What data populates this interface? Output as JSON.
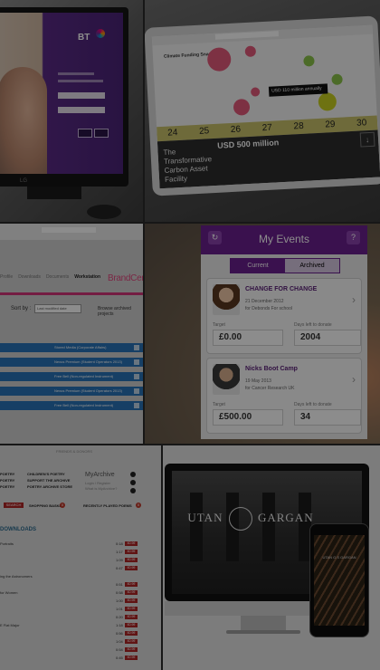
{
  "tile_bt": {
    "brand": "BT",
    "monitor_logo": "LG"
  },
  "tile_timeline": {
    "page_title": "Climate Funding Snapshot",
    "callout": "USD 110 million annually",
    "days": [
      "24",
      "25",
      "26",
      "27",
      "28",
      "29",
      "30"
    ],
    "feature_title": "The Transformative Carbon Asset Facility",
    "feature_amount": "USD 500 million",
    "download_icon": "arrow-down-icon"
  },
  "tile_auction": {
    "nav_items": [
      "Profile",
      "Downloads",
      "Documents",
      "Workstation"
    ],
    "brand_fragment": "BrandCentra",
    "sort_label": "Sort by :",
    "sort_value": "Last modified date",
    "browse_label": "Browse archived projects",
    "row_labels": [
      "Stored Media (Corporate Affairs)",
      "Nexus Premium (Student Operators 2013)",
      "Free Bell (Non-regulated Instrument)",
      "Nexus Premium (Student Operators 2013)",
      "Free Bell (Non-regulated Instrument)"
    ]
  },
  "tile_events": {
    "title": "My Events",
    "tabs": [
      "Current",
      "Archived"
    ],
    "events": [
      {
        "name": "CHANGE FOR CHANGE",
        "date": "21 December 2012",
        "for": "for Debonds For school",
        "target_label": "Target",
        "target": "£0.00",
        "days_label": "Days left to donate",
        "days": "2004"
      },
      {
        "name": "Nicks Boot Camp",
        "date": "19 May 2013",
        "for": "for Cancer Research UK",
        "target_label": "Target",
        "target": "£500.00",
        "days_label": "Days left to donate",
        "days": "34"
      }
    ]
  },
  "tile_poetry": {
    "banner": "FRIENDS & DONORS",
    "nav_col1": [
      "POETRY",
      "POETRY",
      "POETRY"
    ],
    "nav_col2": [
      "CHILDREN'S POETRY",
      "SUPPORT THE ARCHIVE",
      "POETRY ARCHIVE STORE"
    ],
    "myarchive": "MyArchive",
    "login_lines": [
      "Login / Register",
      "What is MyArchive?"
    ],
    "search_label": "SEARCH",
    "shopping_label": "SHOPPING BASKET",
    "shopping_count": "0",
    "recent_label": "RECENTLY PLAYED POEMS",
    "recent_count": "0",
    "downloads_heading": "DOWNLOADS",
    "tracks": [
      {
        "title": "Portraits",
        "dur": "0:18",
        "price": "£0.99"
      },
      {
        "title": "",
        "dur": "1:17",
        "price": "£0.99"
      },
      {
        "title": "",
        "dur": "1:09",
        "price": "£0.99"
      },
      {
        "title": "",
        "dur": "0:47",
        "price": "£0.99"
      },
      {
        "title": "ing the Astronomers",
        "dur": "",
        "price": ""
      },
      {
        "title": "",
        "dur": "0:51",
        "price": "£0.99"
      },
      {
        "title": "for Women",
        "dur": "0:58",
        "price": "£0.99"
      },
      {
        "title": "",
        "dur": "1:00",
        "price": "£0.99"
      },
      {
        "title": "",
        "dur": "1:01",
        "price": "£0.99"
      },
      {
        "title": "",
        "dur": "0:20",
        "price": "£0.99"
      },
      {
        "title": "E Flat Major",
        "dur": "1:18",
        "price": "£0.99"
      },
      {
        "title": "",
        "dur": "0:56",
        "price": "£0.99"
      },
      {
        "title": "",
        "dur": "1:04",
        "price": "£0.99"
      },
      {
        "title": "",
        "dur": "0:54",
        "price": "£0.99"
      },
      {
        "title": "",
        "dur": "0:45",
        "price": "£0.99"
      }
    ]
  },
  "tile_devices": {
    "brand_left": "UTAN",
    "brand_mid": "G.S",
    "brand_right": "GARGAN",
    "phone_brand": "UTAN G.S GARGAN"
  }
}
